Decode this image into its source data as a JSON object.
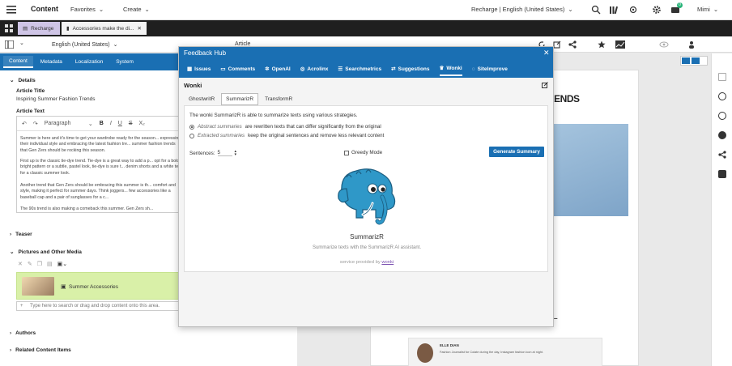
{
  "topbar": {
    "title": "Content",
    "favorites": "Favorites",
    "create": "Create",
    "site": "Recharge | English (United States)",
    "notifications": "0",
    "user": "Mimi"
  },
  "tabs": [
    {
      "label": "Recharge"
    },
    {
      "label": "Accessories make the di..."
    }
  ],
  "toolbar": {
    "language": "English (United States)",
    "doc_type": "Article"
  },
  "form": {
    "tabs": [
      "Content",
      "Metadata",
      "Localization",
      "System"
    ],
    "details_header": "Details",
    "article_title_label": "Article Title",
    "article_title_value": "Inspiring Summer Fashion Trends",
    "article_text_label": "Article Text",
    "paragraph_style": "Paragraph",
    "paragraphs": [
      "Summer is here and it's time to get your wardrobe ready for the season... expressing their individual style and embracing the latest fashion tre... summer fashion trends that Gen Zers should be rocking this season.",
      "First up is the classic tie-dye trend. Tie-dye is a great way to add a p... opt for a bold, bright pattern or a subtle, pastel look, tie-dye is sure t... denim shorts and a white tee for a classic summer look.",
      "Another trend that Gen Zers should be embracing this summer is th... comfort and style, making it perfect for summer days. Think joggers... few accessories like a baseball cap and a pair of sunglasses for a c...",
      "The 90s trend is also making a comeback this summer. Gen Zers sh..."
    ],
    "teaser_header": "Teaser",
    "pictures_header": "Pictures and Other Media",
    "media_item": "Summer Accessories",
    "dropzone_placeholder": "Type here to search or drag and drop content onto this area.",
    "authors_header": "Authors",
    "related_header": "Related Content Items"
  },
  "dialog": {
    "title": "Feedback Hub",
    "tabs": [
      "Issues",
      "Comments",
      "OpenAI",
      "Acrolinx",
      "Searchmetrics",
      "Suggestions",
      "Wonki",
      "SiteImprove"
    ],
    "section_title": "Wonki",
    "subtabs": [
      "GhostwritR",
      "SummarizR",
      "TransformR"
    ],
    "intro": "The wonki SummarizR is able to summarize texts using various strategies.",
    "option_abstract_em": "Abstract summaries",
    "option_abstract_rest": "are rewritten texts that can differ significantly from the original",
    "option_extracted_em": "Extracted summaries",
    "option_extracted_rest": "keep the original sentences and remove less relevant content",
    "sentences_label": "Sentences:",
    "sentences_value": "5",
    "greedy_label": "Greedy Mode",
    "generate_button": "Generate Summary",
    "name": "SummarizR",
    "description": "Summarize texts with the SummarizR AI assistant.",
    "provided_prefix": "service provided by",
    "provider": "wonki"
  },
  "preview": {
    "heading": "RENDS",
    "author_name": "ELLE DIAN",
    "author_bio": "Fashion Journalist for Colate during the day, Instagram fashion icon at night."
  },
  "colors": {
    "accent": "#1a6fb3",
    "media_bg": "#d9f0a8",
    "tab_active": "#cfc5e6",
    "mascot": "#2f98c8"
  }
}
